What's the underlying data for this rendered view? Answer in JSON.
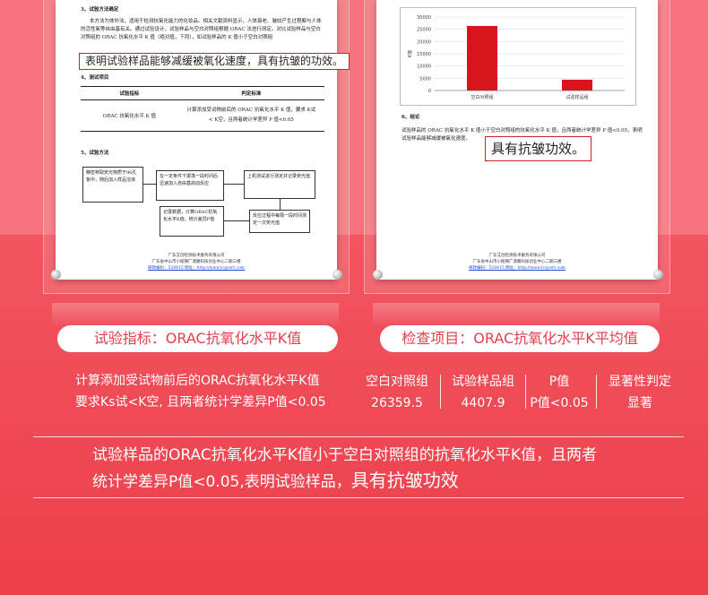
{
  "left_doc": {
    "section_3_title": "3、试验方法确定",
    "intro_text": "本方法为体外法，适用于检测抗氧化能力的化妆品。相关文献资料显示，人体衰老、皱纹产生过程都与人体的活性氧等自由基有关。通过试验设计，试验样品与空白对照组根据 ORAC 法进行测定。对比试验样品与空白对照组的 ORAC 抗氧化水平 K 值（绝对值，下同），如试验样品的 K 值小于空白对照组",
    "highlight_text": "表明试验样品能够减缓被氧化速度，具有抗皱的功效。",
    "section_4_title": "4、测试项目",
    "table_header": [
      "试验指标",
      "判定标准"
    ],
    "table_row": [
      "ORAC 抗氧化水平 K 值",
      "计算添加受试物前后的 ORAC 抗氧化水平 K 值，要求 K试 < K空，且两者统计学差异 P 值<0.05"
    ],
    "section_5_title": "5、试验方法",
    "flow": [
      "精密称取荧光物质于96孔板中，随后加入样品溶液",
      "在一定条件下振荡一段时间后迅速加入自由基启动反应",
      "上机测试进行测定并记录荧光值",
      "反应过程中每隔一段时间测定一次荧光值",
      "记录数据，计算ORAC抗氧化水平K值，统计差异P值"
    ],
    "footer": [
      "广东艾创检测技术服务有限公司",
      "广东省中山市小榄镇广源路科技创业中心二期三楼",
      "邮政编码：528415  网址：http://www.lcqcert.com"
    ]
  },
  "right_doc": {
    "chart_data": {
      "type": "bar",
      "categories": [
        "空白对照组",
        "试验样品组"
      ],
      "values": [
        26359.5,
        4407.9
      ],
      "ylabel": "K值",
      "ylim": [
        0,
        30000
      ],
      "yticks": [
        0,
        5000,
        10000,
        15000,
        20000,
        25000,
        30000
      ],
      "bar_color": "#d8141c"
    },
    "section_6_title": "6、结论",
    "conclusion_text": "试验样品的 ORAC 抗氧化水平 K 值小于空白对照组的抗氧化水平 K 值，且两者统计学差异 P 值<0.05，表明试验样品能够减缓被氧化速度，",
    "highlight_text": "具有抗皱功效。",
    "footer": [
      "广东艾创检测技术服务有限公司",
      "广东省中山市小榄镇广源路科技创业中心二期三楼",
      "邮政编码：528415  网址：http://www.lcqcert.com"
    ]
  },
  "pill_left": "试验指标：ORAC抗氧化水平K值",
  "pill_right": "检查项目：ORAC抗氧化水平K平均值",
  "left_desc_line1": "计算添加受试物前后的ORAC抗氧化水平K值",
  "left_desc_line2": "要求Ks试<K空, 且两者统计学差异P值<0.05",
  "result_columns": [
    {
      "header": "空白对照组",
      "value": "26359.5"
    },
    {
      "header": "试验样品组",
      "value": "4407.9"
    },
    {
      "header": "P值",
      "value": "P值<0.05"
    },
    {
      "header": "显著性判定",
      "value": "显著"
    }
  ],
  "conclusion_line1": "试验样品的ORAC抗氧化水平K值小于空白对照组的抗氧化水平K值，且两者",
  "conclusion_line2_a": "统计学差异P值<0.05,表明试验样品，",
  "conclusion_line2_b": "具有抗皱功效"
}
